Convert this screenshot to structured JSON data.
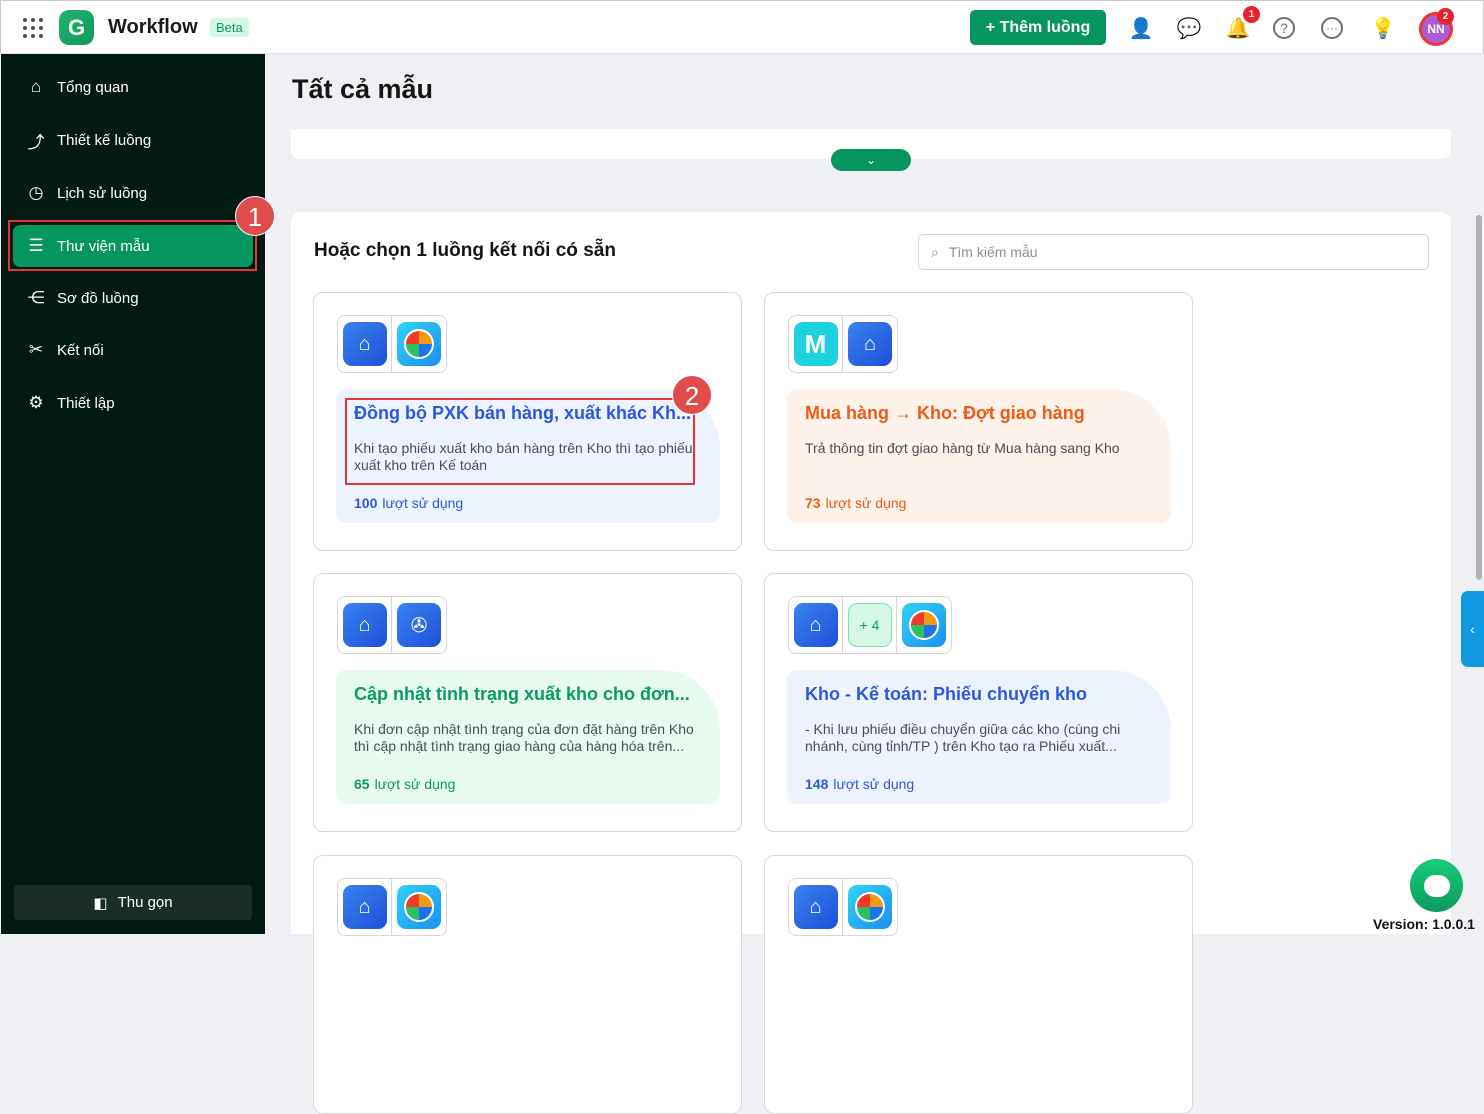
{
  "header": {
    "app_name": "Workflow",
    "badge": "Beta",
    "add_button": "Thêm luồng",
    "notification_count": "1",
    "avatar_initials": "NN",
    "avatar_count": "2"
  },
  "sidebar": {
    "items": [
      {
        "label": "Tổng quan",
        "icon": "home-icon"
      },
      {
        "label": "Thiết kế luồng",
        "icon": "flow-design-icon"
      },
      {
        "label": "Lịch sử luồng",
        "icon": "history-icon"
      },
      {
        "label": "Thư viện mẫu",
        "icon": "menu-icon",
        "active": true
      },
      {
        "label": "Sơ đồ luồng",
        "icon": "share-nodes-icon"
      },
      {
        "label": "Kết nối",
        "icon": "connect-tools-icon"
      },
      {
        "label": "Thiết lập",
        "icon": "gear-icon"
      }
    ],
    "collapse_label": "Thu gọn"
  },
  "main": {
    "title": "Tất cả mẫu",
    "section_title": "Hoặc chọn 1 luồng kết nối có sẵn",
    "search_placeholder": "Tìm kiếm mẫu",
    "usage_suffix": "lượt sử dụng",
    "cards": [
      {
        "title": "Đồng bộ PXK bán hàng, xuất khác Kh...",
        "desc": "Khi tạo phiếu xuất kho bán hàng trên Kho thì tạo phiếu xuất kho trên Kế toán",
        "uses": "100"
      },
      {
        "title": "Mua hàng → Kho: Đợt giao hàng",
        "desc": "Trả thông tin đợt giao hàng từ Mua hàng sang Kho",
        "uses": "73"
      },
      {
        "title": "Cập nhật tình trạng xuất kho cho đơn...",
        "desc": "Khi đơn cập nhật tình trạng của đơn đặt hàng trên Kho thì cập nhật tình trạng giao hàng của hàng hóa trên...",
        "uses": "65"
      },
      {
        "title": "Kho - Kế toán: Phiếu chuyển kho",
        "desc": "- Khi lưu phiếu điều chuyển giữa các kho (cùng chi nhánh, cùng tỉnh/TP ) trên Kho tạo ra Phiếu xuất...",
        "uses": "148",
        "extra_apps": "+ 4"
      }
    ]
  },
  "annotations": [
    "1",
    "2"
  ],
  "version": "Version: 1.0.0.1"
}
